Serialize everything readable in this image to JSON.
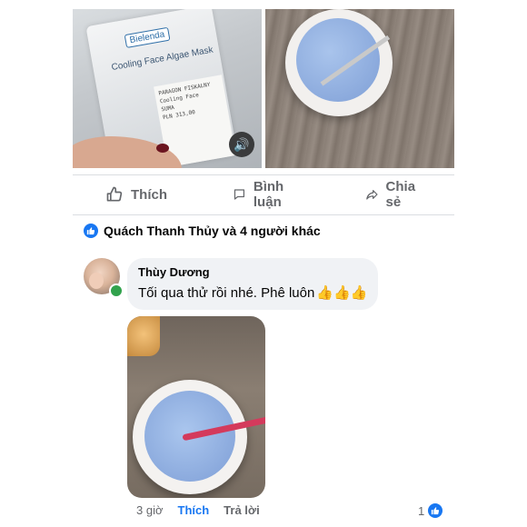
{
  "post_photo_left": {
    "brand": "Bielenda",
    "product": "Cooling Face Algae Mask",
    "receipt_lines": [
      "PARAGON FISKALNY",
      "Cooling Face",
      "SUMA",
      "PLN 313,00"
    ]
  },
  "actions": {
    "like_label": "Thích",
    "comment_label": "Bình luận",
    "share_label": "Chia sẻ"
  },
  "reactions": {
    "text": "Quách Thanh Thủy và 4 người khác"
  },
  "comment": {
    "author": "Thùy Dương",
    "text": "Tối qua thử rồi nhé. Phê luôn",
    "emoji": "👍👍👍",
    "time": "3 giờ",
    "like_label": "Thích",
    "reply_label": "Trả lời",
    "reaction_count": "1"
  },
  "colors": {
    "accent": "#1877f2",
    "muted": "#65676b",
    "bubble": "#f0f2f5",
    "online": "#31a24c"
  }
}
